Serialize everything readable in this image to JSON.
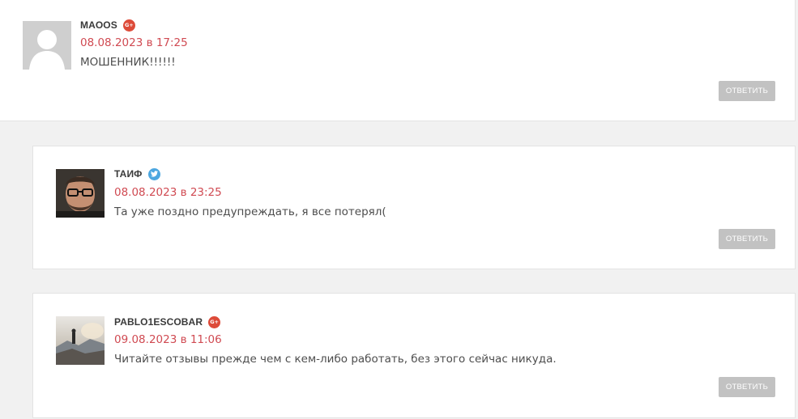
{
  "comments": [
    {
      "author": "MAOOS",
      "social": {
        "type": "google-plus",
        "label": "G+"
      },
      "date": "08.08.2023 в 17:25",
      "text": "МОШЕННИК!!!!!!",
      "reply_label": "ОТВЕТИТЬ",
      "avatar": "default-avatar"
    },
    {
      "author": "ТАИФ",
      "social": {
        "type": "twitter",
        "label": ""
      },
      "date": "08.08.2023 в 23:25",
      "text": "Та уже поздно предупреждать, я все потерял(",
      "reply_label": "ОТВЕТИТЬ",
      "avatar": "user-photo"
    },
    {
      "author": "PABLO1ESCOBAR",
      "social": {
        "type": "google-plus",
        "label": "G+"
      },
      "date": "09.08.2023 в 11:06",
      "text": "Читайте отзывы прежде чем с кем-либо работать, без этого сейчас никуда.",
      "reply_label": "ОТВЕТИТЬ",
      "avatar": "user-photo"
    }
  ],
  "colors": {
    "date": "#d04a52",
    "reply_button": "#c2c2c2",
    "google_plus": "#dd4b39",
    "twitter": "#4da7e0",
    "page_background": "#f1f1f1"
  }
}
